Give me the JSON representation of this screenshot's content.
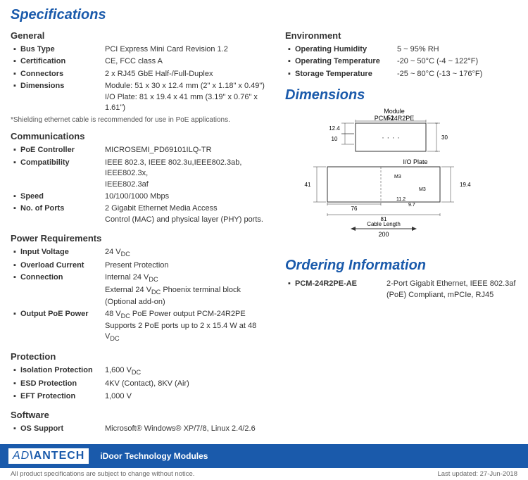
{
  "title": "Specifications",
  "left": {
    "sections": [
      {
        "id": "general",
        "title": "General",
        "rows": [
          {
            "label": "Bus Type",
            "value": "PCI Express Mini Card Revision 1.2"
          },
          {
            "label": "Certification",
            "value": "CE, FCC class A"
          },
          {
            "label": "Connectors",
            "value": "2 x RJ45 GbE Half-/Full-Duplex"
          },
          {
            "label": "Dimensions",
            "value": "Module: 51 x 30 x 12.4 mm (2\" x 1.18\" x 0.49\")\nI/O Plate: 81 x 19.4 x 41 mm (3.19\" x 0.76\" x 1.61\")"
          }
        ],
        "note": "*Shielding ethernet cable is recommended for use in PoE applications."
      },
      {
        "id": "communications",
        "title": "Communications",
        "rows": [
          {
            "label": "PoE Controller",
            "value": "MICROSEMI_PD69101ILQ-TR"
          },
          {
            "label": "Compatibility",
            "value": "IEEE 802.3, IEEE 802.3u,IEEE802.3ab, IEEE802.3x,\nIEEE802.3af"
          },
          {
            "label": "Speed",
            "value": "10/100/1000 Mbps"
          },
          {
            "label": "No. of Ports",
            "value": "2 Gigabit Ethernet Media Access\nControl (MAC) and physical layer (PHY) ports."
          }
        ]
      },
      {
        "id": "power",
        "title": "Power Requirements",
        "rows": [
          {
            "label": "Input Voltage",
            "value": "24 VDC"
          },
          {
            "label": "Overload Current",
            "value": "Present Protection"
          },
          {
            "label": "Connection",
            "value": "Internal 24 VDC\nExternal 24 VDC Phoenix terminal block (Optional add-on)"
          },
          {
            "label": "Output PoE Power",
            "value": "48 VDC PoE Power output PCM-24R2PE\nSupports 2 PoE ports up to 2 x 15.4 W at 48 VDC"
          }
        ]
      },
      {
        "id": "protection",
        "title": "Protection",
        "rows": [
          {
            "label": "Isolation Protection",
            "value": "1,600 VDC"
          },
          {
            "label": "ESD Protection",
            "value": "4KV (Contact), 8KV (Air)"
          },
          {
            "label": "EFT Protection",
            "value": "1,000 V"
          }
        ]
      },
      {
        "id": "software",
        "title": "Software",
        "rows": [
          {
            "label": "OS Support",
            "value": "Microsoft® Windows® XP/7/8, Linux 2.4/2.6"
          }
        ]
      }
    ]
  },
  "right": {
    "environment": {
      "title": "Environment",
      "rows": [
        {
          "label": "Operating Humidity",
          "value": "5 ~ 95% RH"
        },
        {
          "label": "Operating Temperature",
          "value": "-20 ~ 50°C (-4 ~ 122°F)"
        },
        {
          "label": "Storage Temperature",
          "value": "-25 ~ 80°C (-13 ~ 176°F)"
        }
      ]
    },
    "dimensions": {
      "title": "Dimensions",
      "module_label": "Module",
      "module_name": "PCM-24R2PE",
      "io_label": "I/O Plate",
      "cable_label": "Cable Length",
      "cable_value": "200",
      "dims": {
        "top_width": "51",
        "top_height1": "12.4",
        "top_height2": "10",
        "top_right": "30",
        "bottom_left": "41",
        "bottom_width": "76",
        "bottom_total": "81",
        "bottom_height": "19.4",
        "m3_1": "M3",
        "m3_2": "M3",
        "sub1": "11.2",
        "sub2": "9.7"
      }
    },
    "ordering": {
      "title": "Ordering Information",
      "items": [
        {
          "pn": "PCM-24R2PE-AE",
          "desc": "2-Port Gigabit Ethernet, IEEE 802.3af (PoE) Compliant, mPCIe, RJ45"
        }
      ]
    }
  },
  "footer": {
    "logo": "AD\\ANTECH",
    "slogan": "iDoor Technology Modules",
    "note_left": "All product specifications are subject to change without notice.",
    "note_right": "Last updated: 27-Jun-2018"
  },
  "bullet": "▪"
}
